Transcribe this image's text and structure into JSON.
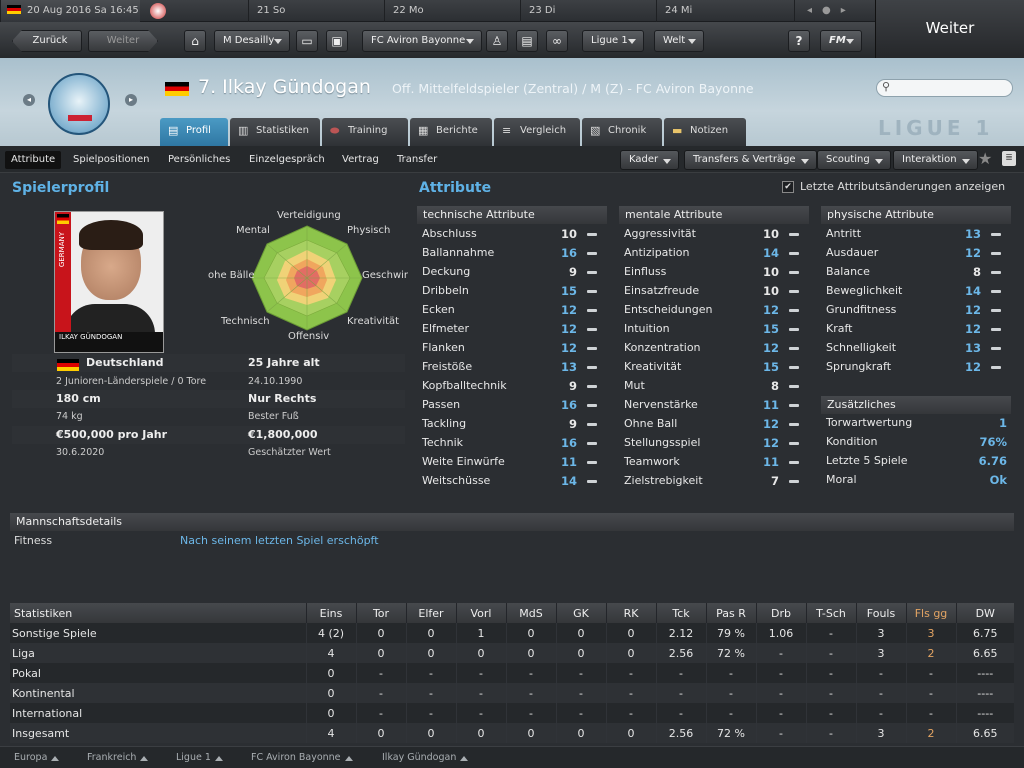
{
  "datebar": {
    "current": "20 Aug 2016  Sa 16:45",
    "days": [
      "21 So",
      "22 Mo",
      "23 Di",
      "24 Mi"
    ]
  },
  "nav": {
    "back": "Zurück",
    "forward": "Weiter",
    "manager": "M Desailly",
    "club": "FC Aviron Bayonne",
    "league": "Ligue 1",
    "world": "Welt",
    "help": "?",
    "fm": "FM",
    "continue": "Weiter"
  },
  "player": {
    "number_name": "7. Ilkay Gündogan",
    "subtitle": "Off. Mittelfeldspieler (Zentral) / M (Z) - FC Aviron Bayonne",
    "photo_band": "GERMANY",
    "photo_caption": "ILKAY GÜNDOGAN"
  },
  "search": {
    "placeholder": ""
  },
  "header": {
    "league_watermark": "LIGUE 1"
  },
  "tabs": [
    "Profil",
    "Statistiken",
    "Training",
    "Berichte",
    "Vergleich",
    "Chronik",
    "Notizen"
  ],
  "subnav": {
    "items": [
      "Attribute",
      "Spielpositionen",
      "Persönliches",
      "Einzelgespräch",
      "Vertrag",
      "Transfer"
    ],
    "buttons": [
      "Kader",
      "Transfers & Verträge",
      "Scouting",
      "Interaktion"
    ]
  },
  "profile": {
    "title": "Spielerprofil",
    "nation": "Deutschland",
    "caps": "2 Junioren-Länderspiele / 0 Tore",
    "age": "25 Jahre alt",
    "dob": "24.10.1990",
    "height": "180 cm",
    "weight": "74 kg",
    "foot": "Nur Rechts",
    "foot_label": "Bester Fuß",
    "wage": "€500,000 pro Jahr",
    "contract": "30.6.2020",
    "value": "€1,800,000",
    "value_label": "Geschätzter Wert",
    "radar_labels": [
      "Verteidigung",
      "Physisch",
      "Geschwir",
      "Kreativität",
      "Offensiv",
      "Technisch",
      "ohe Bälle",
      "Mental"
    ]
  },
  "attributes": {
    "title": "Attribute",
    "show_changes": "Letzte Attributsänderungen anzeigen",
    "technical": {
      "title": "technische Attribute",
      "rows": [
        {
          "name": "Abschluss",
          "value": "10",
          "hi": false
        },
        {
          "name": "Ballannahme",
          "value": "16",
          "hi": true
        },
        {
          "name": "Deckung",
          "value": "9",
          "hi": false
        },
        {
          "name": "Dribbeln",
          "value": "15",
          "hi": true
        },
        {
          "name": "Ecken",
          "value": "12",
          "hi": true
        },
        {
          "name": "Elfmeter",
          "value": "12",
          "hi": true
        },
        {
          "name": "Flanken",
          "value": "12",
          "hi": true
        },
        {
          "name": "Freistöße",
          "value": "13",
          "hi": true
        },
        {
          "name": "Kopfballtechnik",
          "value": "9",
          "hi": false
        },
        {
          "name": "Passen",
          "value": "16",
          "hi": true
        },
        {
          "name": "Tackling",
          "value": "9",
          "hi": false
        },
        {
          "name": "Technik",
          "value": "16",
          "hi": true
        },
        {
          "name": "Weite Einwürfe",
          "value": "11",
          "hi": true
        },
        {
          "name": "Weitschüsse",
          "value": "14",
          "hi": true
        }
      ]
    },
    "mental": {
      "title": "mentale Attribute",
      "rows": [
        {
          "name": "Aggressivität",
          "value": "10",
          "hi": false
        },
        {
          "name": "Antizipation",
          "value": "14",
          "hi": true
        },
        {
          "name": "Einfluss",
          "value": "10",
          "hi": false
        },
        {
          "name": "Einsatzfreude",
          "value": "10",
          "hi": false
        },
        {
          "name": "Entscheidungen",
          "value": "12",
          "hi": true
        },
        {
          "name": "Intuition",
          "value": "15",
          "hi": true
        },
        {
          "name": "Konzentration",
          "value": "12",
          "hi": true
        },
        {
          "name": "Kreativität",
          "value": "15",
          "hi": true
        },
        {
          "name": "Mut",
          "value": "8",
          "hi": false
        },
        {
          "name": "Nervenstärke",
          "value": "11",
          "hi": true
        },
        {
          "name": "Ohne Ball",
          "value": "12",
          "hi": true
        },
        {
          "name": "Stellungsspiel",
          "value": "12",
          "hi": true
        },
        {
          "name": "Teamwork",
          "value": "11",
          "hi": true
        },
        {
          "name": "Zielstrebigkeit",
          "value": "7",
          "hi": false
        }
      ]
    },
    "physical": {
      "title": "physische Attribute",
      "rows": [
        {
          "name": "Antritt",
          "value": "13",
          "hi": true
        },
        {
          "name": "Ausdauer",
          "value": "12",
          "hi": true
        },
        {
          "name": "Balance",
          "value": "8",
          "hi": false
        },
        {
          "name": "Beweglichkeit",
          "value": "14",
          "hi": true
        },
        {
          "name": "Grundfitness",
          "value": "12",
          "hi": true
        },
        {
          "name": "Kraft",
          "value": "12",
          "hi": true
        },
        {
          "name": "Schnelligkeit",
          "value": "13",
          "hi": true
        },
        {
          "name": "Sprungkraft",
          "value": "12",
          "hi": true
        }
      ]
    },
    "extra": {
      "title": "Zusätzliches",
      "rows": [
        {
          "name": "Torwartwertung",
          "value": "1",
          "hi": true
        },
        {
          "name": "Kondition",
          "value": "76%",
          "hi": true
        },
        {
          "name": "Letzte 5 Spiele",
          "value": "6.76",
          "hi": true
        },
        {
          "name": "Moral",
          "value": "Ok",
          "hi": true
        }
      ]
    }
  },
  "team": {
    "title": "Mannschaftsdetails",
    "fitness_label": "Fitness",
    "fitness_value": "Nach seinem letzten Spiel erschöpft"
  },
  "stats": {
    "headers": [
      "Statistiken",
      "Eins",
      "Tor",
      "Elfer",
      "Vorl",
      "MdS",
      "GK",
      "RK",
      "Tck",
      "Pas R",
      "Drb",
      "T-Sch",
      "Fouls",
      "Fls gg",
      "DW"
    ],
    "rows": [
      [
        "Sonstige Spiele",
        "4 (2)",
        "0",
        "0",
        "1",
        "0",
        "0",
        "0",
        "2.12",
        "79 %",
        "1.06",
        "-",
        "3",
        "3",
        "6.75"
      ],
      [
        "Liga",
        "4",
        "0",
        "0",
        "0",
        "0",
        "0",
        "0",
        "2.56",
        "72 %",
        "-",
        "-",
        "3",
        "2",
        "6.65"
      ],
      [
        "Pokal",
        "0",
        "-",
        "-",
        "-",
        "-",
        "-",
        "-",
        "-",
        "-",
        "-",
        "-",
        "-",
        "-",
        "----"
      ],
      [
        "Kontinental",
        "0",
        "-",
        "-",
        "-",
        "-",
        "-",
        "-",
        "-",
        "-",
        "-",
        "-",
        "-",
        "-",
        "----"
      ],
      [
        "International",
        "0",
        "-",
        "-",
        "-",
        "-",
        "-",
        "-",
        "-",
        "-",
        "-",
        "-",
        "-",
        "-",
        "----"
      ],
      [
        "Insgesamt",
        "4",
        "0",
        "0",
        "0",
        "0",
        "0",
        "0",
        "2.56",
        "72 %",
        "-",
        "-",
        "3",
        "2",
        "6.65"
      ]
    ]
  },
  "footer": {
    "breadcrumbs": [
      "Europa",
      "Frankreich",
      "Ligue 1",
      "FC Aviron Bayonne",
      "Ilkay Gündogan"
    ]
  }
}
